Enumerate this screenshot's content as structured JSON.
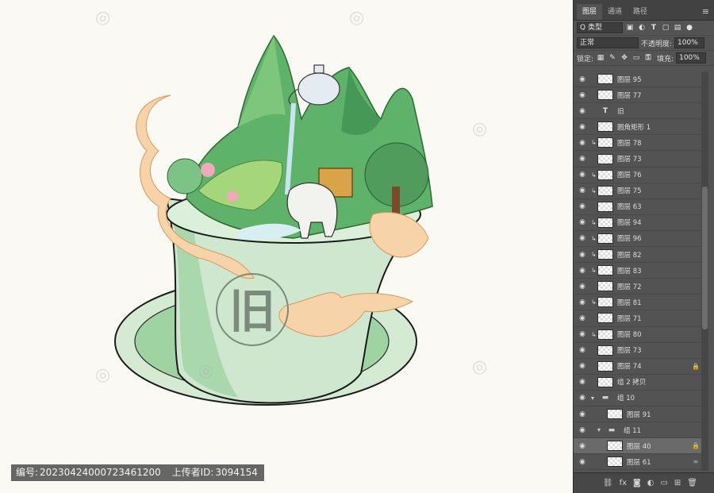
{
  "panel": {
    "tabs": [
      "图层",
      "通道",
      "路径"
    ],
    "filter_kind": "Q 类型",
    "blend_mode": "正常",
    "opacity_label": "不透明度:",
    "opacity_value": "100%",
    "lock_label": "锁定:",
    "fill_label": "填充:",
    "fill_value": "100%",
    "menu_icon": "hamburger-icon",
    "layers": [
      {
        "name": "图层 95",
        "clip": false,
        "type": "pixel",
        "tail": ""
      },
      {
        "name": "图层 77",
        "clip": false,
        "type": "pixel",
        "tail": ""
      },
      {
        "name": "旧",
        "clip": false,
        "type": "text",
        "tail": ""
      },
      {
        "name": "圆角矩形 1",
        "clip": false,
        "type": "shape",
        "tail": ""
      },
      {
        "name": "图层 78",
        "clip": true,
        "type": "pixel",
        "tail": ""
      },
      {
        "name": "图层 73",
        "clip": false,
        "type": "pixel",
        "tail": ""
      },
      {
        "name": "图层 76",
        "clip": true,
        "type": "pixel",
        "tail": ""
      },
      {
        "name": "图层 75",
        "clip": true,
        "type": "pixel",
        "tail": ""
      },
      {
        "name": "图层 63",
        "clip": false,
        "type": "pixel",
        "tail": ""
      },
      {
        "name": "图层 94",
        "clip": true,
        "type": "pixel",
        "tail": ""
      },
      {
        "name": "图层 96",
        "clip": true,
        "type": "pixel",
        "tail": ""
      },
      {
        "name": "图层 82",
        "clip": true,
        "type": "pixel",
        "tail": ""
      },
      {
        "name": "图层 83",
        "clip": true,
        "type": "pixel",
        "tail": ""
      },
      {
        "name": "图层 72",
        "clip": false,
        "type": "pixel",
        "tail": ""
      },
      {
        "name": "图层 81",
        "clip": true,
        "type": "pixel",
        "tail": ""
      },
      {
        "name": "图层 71",
        "clip": false,
        "type": "pixel",
        "tail": ""
      },
      {
        "name": "图层 80",
        "clip": true,
        "type": "pixel",
        "tail": ""
      },
      {
        "name": "图层 73",
        "clip": false,
        "type": "pixel",
        "tail": ""
      },
      {
        "name": "图层 74",
        "clip": false,
        "type": "pixel",
        "tail": "lock-icon"
      },
      {
        "name": "组 2 拷贝",
        "clip": false,
        "type": "group",
        "tail": ""
      },
      {
        "name": "组 10",
        "clip": false,
        "type": "folder",
        "tail": ""
      },
      {
        "name": "图层 91",
        "clip": false,
        "type": "pixel",
        "tail": ""
      },
      {
        "name": "组 11",
        "clip": false,
        "type": "folder",
        "tail": ""
      },
      {
        "name": "图层 40",
        "clip": false,
        "type": "pixel",
        "tail": "lock-icon",
        "selected": true
      },
      {
        "name": "图层 61",
        "clip": false,
        "type": "pixel",
        "tail": "link-icon"
      }
    ]
  },
  "canvas": {
    "seal_text": "旧",
    "footer": {
      "id_label": "编号:",
      "id_value": "20230424000723461200",
      "uploader_label": "上传者ID:",
      "uploader_value": "3094154"
    },
    "colors": {
      "cup": "#cfe6cf",
      "cup_dark": "#7fc58e",
      "mountain": "#5fb26a",
      "cloud": "#f2c18e"
    }
  }
}
